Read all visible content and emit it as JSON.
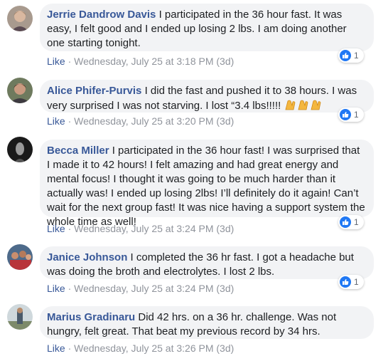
{
  "comments": [
    {
      "author": "Jerrie Dandrow Davis",
      "text": "I participated in the 36 hour fast. It was easy, I felt good and I ended up losing 2 lbs. I am doing another one starting tonight.",
      "like_label": "Like",
      "sep": "·",
      "timestamp": "Wednesday, July 25 at 3:18 PM (3d)",
      "reaction_count": "1",
      "avatar_icon": "profile-photo"
    },
    {
      "author": "Alice Phifer-Purvis",
      "text": "I did the fast and pushed it to 38 hours. I was very surprised I was not starving. I lost “3.4 lbs!!!!!",
      "emoji": "clapping-hands x3",
      "like_label": "Like",
      "sep": "·",
      "timestamp": "Wednesday, July 25 at 3:20 PM (3d)",
      "reaction_count": "1",
      "avatar_icon": "profile-photo"
    },
    {
      "author": "Becca Miller",
      "text": "I participated in the 36 hour fast! I was surprised that I made it to 42 hours! I felt amazing and had great energy and mental focus! I thought it was going to be much harder than it actually was! I ended up losing 2lbs! I’ll definitely do it again! Can’t wait for the next group fast! It was nice having a support system the whole time as well!",
      "like_label": "Like",
      "sep": "·",
      "timestamp": "Wednesday, July 25 at 3:24 PM (3d)",
      "reaction_count": "1",
      "avatar_icon": "profile-photo"
    },
    {
      "author": "Janice Johnson",
      "text": "I completed the 36 hr fast. I got a headache but was doing the broth and electrolytes. I lost 2 lbs.",
      "like_label": "Like",
      "sep": "·",
      "timestamp": "Wednesday, July 25 at 3:24 PM (3d)",
      "reaction_count": "1",
      "avatar_icon": "profile-photo"
    },
    {
      "author": "Marius Gradinaru",
      "text": "Did 42 hrs. on a 36 hr. challenge. Was not hungry, felt great. That beat my previous record by 34 hrs.",
      "like_label": "Like",
      "sep": "·",
      "timestamp": "Wednesday, July 25 at 3:26 PM (3d)",
      "avatar_icon": "profile-photo"
    }
  ],
  "colors": {
    "author": "#385898",
    "bubble": "#f2f3f5",
    "meta": "#90949c",
    "reaction": "#2078f4"
  }
}
